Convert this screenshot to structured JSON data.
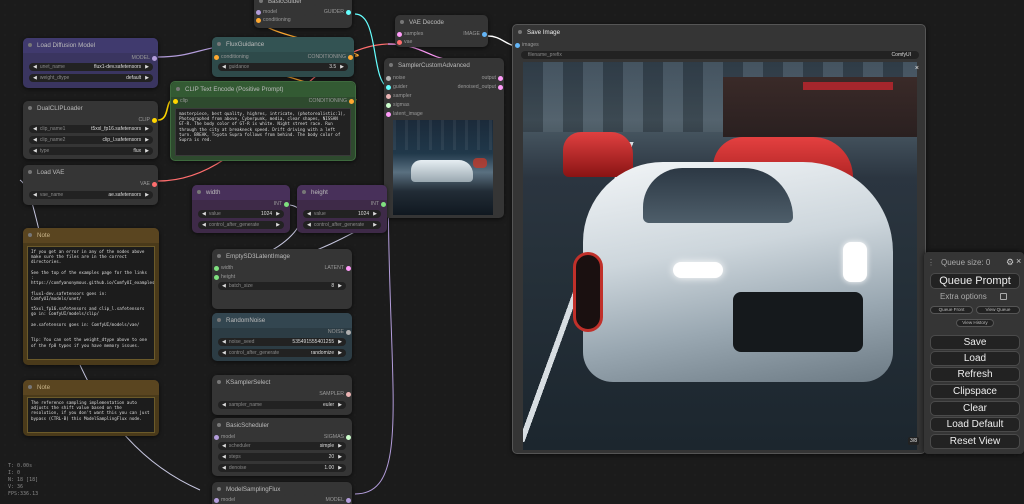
{
  "nodes": {
    "basic_guider": {
      "title": "BasicGuider",
      "inputs": [
        "model",
        "conditioning"
      ],
      "output": "GUIDER"
    },
    "flux_guidance": {
      "title": "FluxGuidance",
      "input": "conditioning",
      "output": "CONDITIONING",
      "widget": {
        "label": "guidance",
        "value": "3.5"
      }
    },
    "load_diffusion": {
      "title": "Load Diffusion Model",
      "output": "MODEL",
      "widgets": [
        {
          "label": "unet_name",
          "value": "flux1-dev.safetensors"
        },
        {
          "label": "weight_dtype",
          "value": "default"
        }
      ]
    },
    "dual_clip": {
      "title": "DualCLIPLoader",
      "output": "CLIP",
      "widgets": [
        {
          "label": "clip_name1",
          "value": "t5xxl_fp16.safetensors"
        },
        {
          "label": "clip_name2",
          "value": "clip_l.safetensors"
        },
        {
          "label": "type",
          "value": "flux"
        }
      ]
    },
    "load_vae": {
      "title": "Load VAE",
      "output": "VAE",
      "widget": {
        "label": "vae_name",
        "value": "ae.safetensors"
      }
    },
    "clip_text": {
      "title": "CLIP Text Encode (Positive Prompt)",
      "input": "clip",
      "output": "CONDITIONING",
      "text": "masterpiece, best quality, highres, intricate, (photorealistic:1), Photographed from above, Cyberpunk, media, clear shapes, NISSAN GT-R. The body color of GT-R is white. Night street race. Run through the city at breakneck speed. Drift driving with a left turn. BREAK, Toyota Supra follows from behind. The body color of Supra is red."
    },
    "vae_decode": {
      "title": "VAE Decode",
      "inputs": [
        "samples",
        "vae"
      ],
      "output": "IMAGE"
    },
    "sampler_adv": {
      "title": "SamplerCustomAdvanced",
      "inputs": [
        "noise",
        "guider",
        "sampler",
        "sigmas",
        "latent_image"
      ],
      "outputs": [
        "output",
        "denoised_output"
      ]
    },
    "width": {
      "title": "width",
      "output": "INT",
      "widgets": [
        {
          "label": "value",
          "value": "1024"
        },
        {
          "label": "control_after_generate",
          "value": ""
        }
      ]
    },
    "height": {
      "title": "height",
      "output": "INT",
      "widgets": [
        {
          "label": "value",
          "value": "1024"
        },
        {
          "label": "control_after_generate",
          "value": ""
        }
      ]
    },
    "empty_latent": {
      "title": "EmptySD3LatentImage",
      "inputs": [
        "width",
        "height"
      ],
      "output": "LATENT",
      "widget": {
        "label": "batch_size",
        "value": "8"
      }
    },
    "random_noise": {
      "title": "RandomNoise",
      "output": "NOISE",
      "widgets": [
        {
          "label": "noise_seed",
          "value": "535491555401255"
        },
        {
          "label": "control_after_generate",
          "value": "randomize"
        }
      ]
    },
    "ksampler_select": {
      "title": "KSamplerSelect",
      "output": "SAMPLER",
      "widget": {
        "label": "sampler_name",
        "value": "euler"
      }
    },
    "basic_scheduler": {
      "title": "BasicScheduler",
      "input": "model",
      "output": "SIGMAS",
      "widgets": [
        {
          "label": "scheduler",
          "value": "simple"
        },
        {
          "label": "steps",
          "value": "20"
        },
        {
          "label": "denoise",
          "value": "1.00"
        }
      ]
    },
    "model_sampling": {
      "title": "ModelSamplingFlux",
      "input": "model",
      "output": "MODEL"
    },
    "save_image": {
      "title": "Save Image",
      "input": "images",
      "widget": {
        "label": "filename_prefix",
        "value": "ComfyUI"
      },
      "counter": "3/8",
      "close": "×"
    },
    "note1": {
      "title": "Note",
      "text": "If you get an error in any of the nodes above make sure the files are in the correct directories.\n\nSee the top of the examples page for the links : https://comfyanonymous.github.io/ComfyUI_examples/flux/\n\nflux1-dev.safetensors goes in: ComfyUI/models/unet/\n\nt5xxl_fp16.safetensors and clip_l.safetensors go in: ComfyUI/models/clip/\n\nae.safetensors goes in: ComfyUI/models/vae/\n\n\nTip: You can set the weight_dtype above to one of the fp8 types if you have memory issues."
    },
    "note2": {
      "title": "Note",
      "text": "The reference sampling implementation auto adjusts the shift value based on the resolution, if you don't want this you can just bypass (CTRL-B) this ModelSamplingFlux node."
    }
  },
  "stats": [
    "T: 0.00s",
    "I: 0",
    "N: 18 [18]",
    "V: 36",
    "FPS:336.13"
  ],
  "queue": {
    "size_label": "Queue size: 0",
    "queue_prompt": "Queue Prompt",
    "extra_options": "Extra options",
    "queue_front": "Queue Front",
    "view_queue": "View Queue",
    "view_history": "View History",
    "buttons": [
      "Save",
      "Load",
      "Refresh",
      "Clipspace",
      "Clear",
      "Load Default",
      "Reset View"
    ]
  },
  "colors": {
    "model": "#b39ddb",
    "clip": "#ffd500",
    "vae": "#ff6e6e",
    "conditioning": "#ffa931",
    "latent": "#ff9cf9",
    "image": "#64b5f6",
    "int": "#7fe07f",
    "guider": "#66ffff",
    "sampler": "#ecb4b4",
    "sigmas": "#cdffcd",
    "noise": "#b0b0b0"
  }
}
